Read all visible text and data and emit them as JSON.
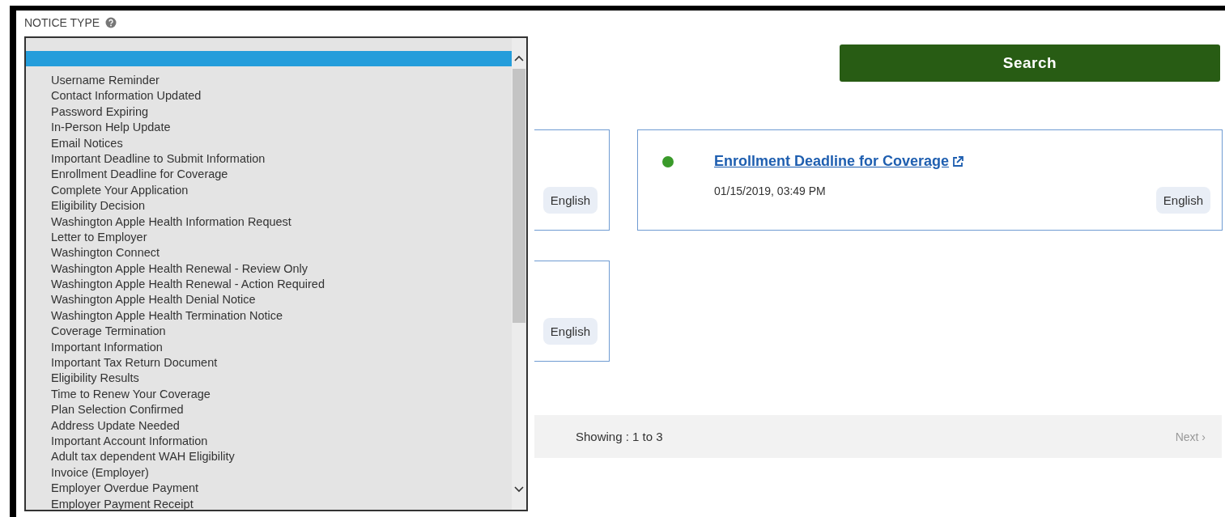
{
  "search_button": {
    "label": "Search"
  },
  "cards": [
    {
      "language": "English"
    },
    {
      "color": "#3a9a2a",
      "title": "Enrollment Deadline for Coverage",
      "date": "01/15/2019, 03:49 PM",
      "language": "English"
    },
    {
      "language": "English"
    }
  ],
  "pagination": {
    "summary": "Showing : 1 to 3",
    "next": "Next ›"
  },
  "notice_type": {
    "label": "NOTICE TYPE",
    "options": [
      {
        "selected": true
      },
      {
        "label": "Username Reminder",
        "selected": false
      },
      {
        "label": "Contact Information Updated",
        "selected": false
      },
      {
        "label": "Password Expiring",
        "selected": false
      },
      {
        "label": "In-Person Help Update",
        "selected": false
      },
      {
        "label": "Email Notices",
        "selected": false
      },
      {
        "label": "Important Deadline to Submit Information",
        "selected": false
      },
      {
        "label": "Enrollment Deadline for Coverage",
        "selected": false
      },
      {
        "label": "Complete Your Application",
        "selected": false
      },
      {
        "label": "Eligibility Decision",
        "selected": false
      },
      {
        "label": "Washington Apple Health Information Request",
        "selected": false
      },
      {
        "label": "Letter to Employer",
        "selected": false
      },
      {
        "label": "Washington Connect",
        "selected": false
      },
      {
        "label": "Washington Apple Health Renewal - Review Only",
        "selected": false
      },
      {
        "label": "Washington Apple Health Renewal - Action Required",
        "selected": false
      },
      {
        "label": "Washington Apple Health Denial Notice",
        "selected": false
      },
      {
        "label": "Washington Apple Health Termination Notice",
        "selected": false
      },
      {
        "label": "Coverage Termination",
        "selected": false
      },
      {
        "label": "Important Information",
        "selected": false
      },
      {
        "label": "Important Tax Return Document",
        "selected": false
      },
      {
        "label": "Eligibility Results",
        "selected": false
      },
      {
        "label": "Time to Renew Your Coverage",
        "selected": false
      },
      {
        "label": "Plan Selection Confirmed",
        "selected": false
      },
      {
        "label": "Address Update Needed",
        "selected": false
      },
      {
        "label": "Important Account Information",
        "selected": false
      },
      {
        "label": "Adult tax dependent WAH Eligibility",
        "selected": false
      },
      {
        "label": "Invoice (Employer)",
        "selected": false
      },
      {
        "label": "Employer Overdue Payment",
        "selected": false
      },
      {
        "label": "Employer Payment Receipt",
        "selected": false
      }
    ]
  }
}
